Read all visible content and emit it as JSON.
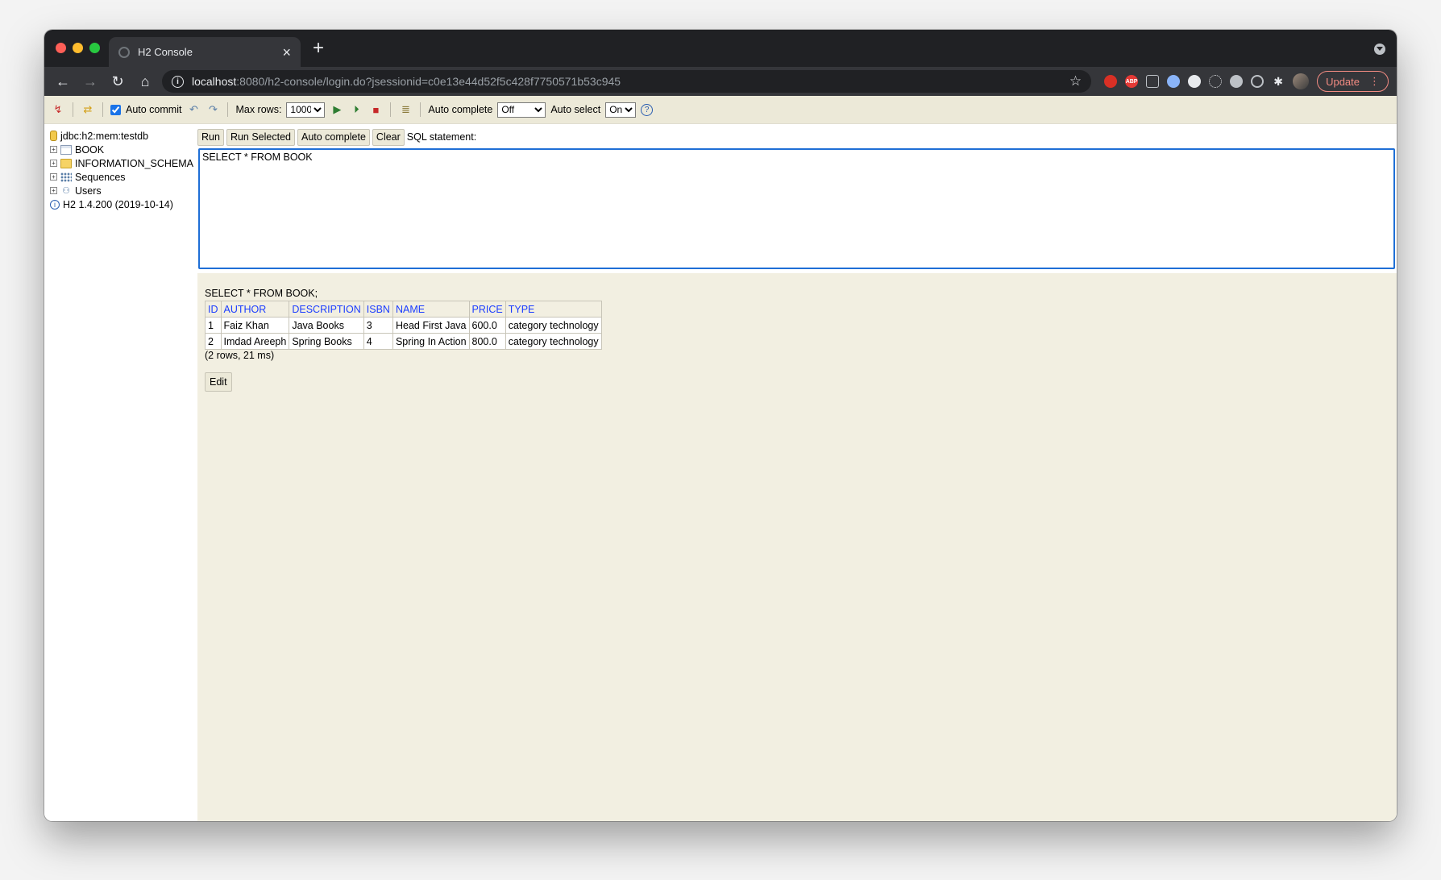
{
  "browser": {
    "tab_title": "H2 Console",
    "url_host": "localhost",
    "url_rest": ":8080/h2-console/login.do?jsessionid=c0e13e44d52f5c428f7750571b53c945",
    "update_label": "Update",
    "abp_label": "ABP"
  },
  "toolbar": {
    "auto_commit_label": "Auto commit",
    "auto_commit_checked": true,
    "max_rows_label": "Max rows:",
    "max_rows_value": "1000",
    "auto_complete_label": "Auto complete",
    "auto_complete_value": "Off",
    "auto_select_label": "Auto select",
    "auto_select_value": "On",
    "help_label": "?"
  },
  "tree": {
    "connection": "jdbc:h2:mem:testdb",
    "items": [
      "BOOK",
      "INFORMATION_SCHEMA",
      "Sequences",
      "Users"
    ],
    "version": "H2 1.4.200 (2019-10-14)"
  },
  "query_bar": {
    "run": "Run",
    "run_selected": "Run Selected",
    "auto_complete": "Auto complete",
    "clear": "Clear",
    "sql_label": "SQL statement:"
  },
  "editor": {
    "sql": "SELECT * FROM BOOK"
  },
  "result": {
    "statement": "SELECT * FROM BOOK;",
    "columns": [
      "ID",
      "AUTHOR",
      "DESCRIPTION",
      "ISBN",
      "NAME",
      "PRICE",
      "TYPE"
    ],
    "rows": [
      [
        "1",
        "Faiz Khan",
        "Java Books",
        "3",
        "Head First Java",
        "600.0",
        "category technology"
      ],
      [
        "2",
        "Imdad Areeph",
        "Spring Books",
        "4",
        "Spring In Action",
        "800.0",
        "category technology"
      ]
    ],
    "summary": "(2 rows, 21 ms)",
    "edit_label": "Edit"
  }
}
